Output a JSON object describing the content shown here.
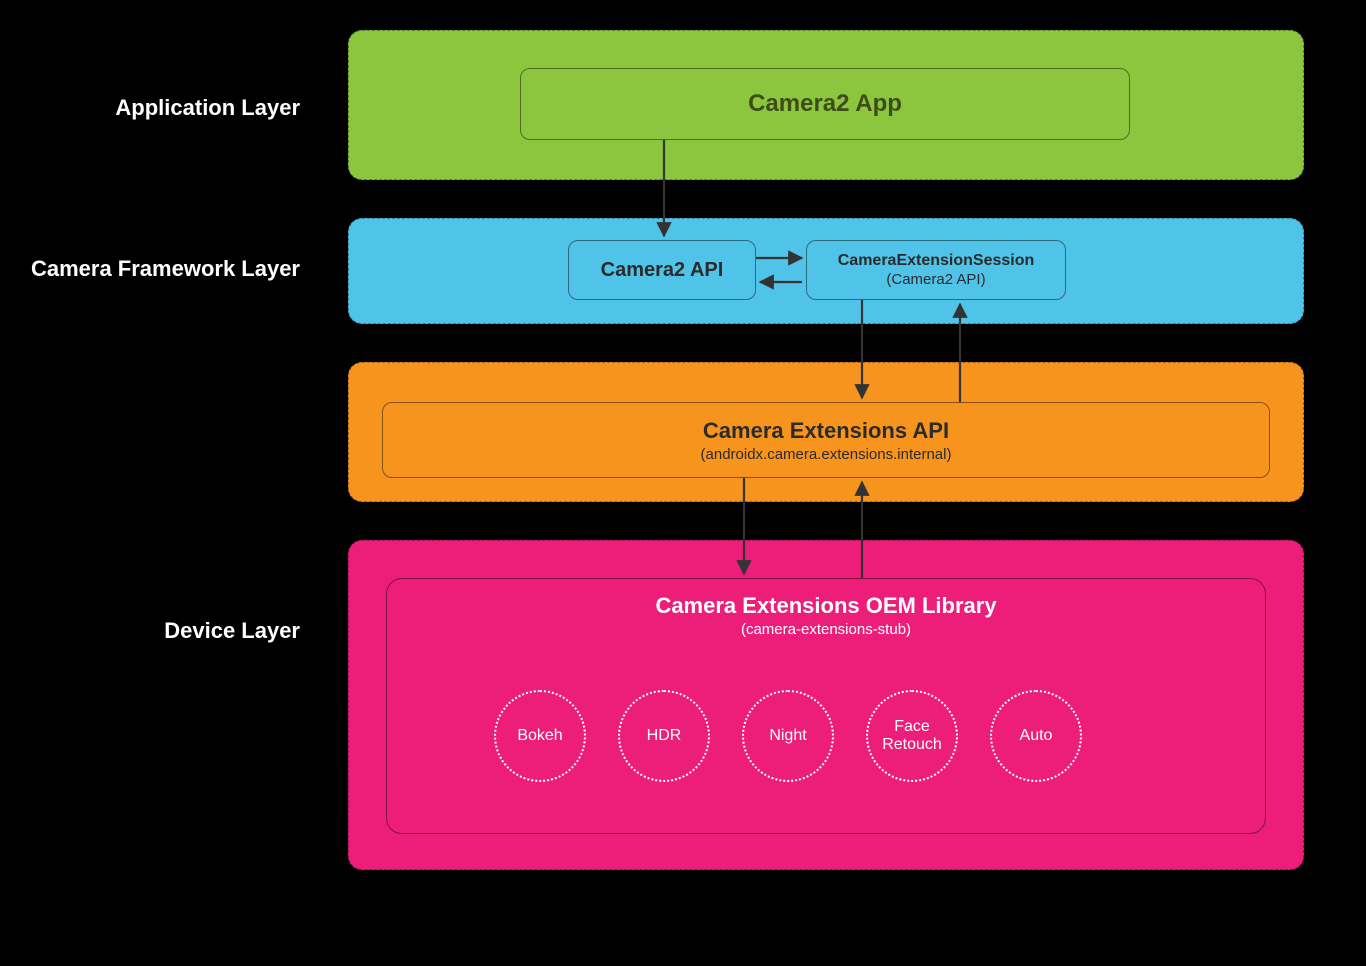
{
  "labels": {
    "application": "Application Layer",
    "framework": "Camera Framework Layer",
    "device": "Device Layer"
  },
  "app": {
    "title": "Camera2 App"
  },
  "framework": {
    "camera2api": "Camera2 API",
    "ext_session_line1": "CameraExtensionSession",
    "ext_session_line2": "(Camera2 API)"
  },
  "extapi": {
    "title": "Camera Extensions API",
    "sub": "(androidx.camera.extensions.internal)"
  },
  "oem": {
    "title": "Camera Extensions OEM Library",
    "sub": "(camera-extensions-stub)",
    "features": [
      "Bokeh",
      "HDR",
      "Night",
      "Face\nRetouch",
      "Auto"
    ]
  },
  "colors": {
    "green": "#8cc63f",
    "blue": "#4fc3e8",
    "orange": "#f7941e",
    "pink": "#ec1e79",
    "arrow": "#333333"
  }
}
